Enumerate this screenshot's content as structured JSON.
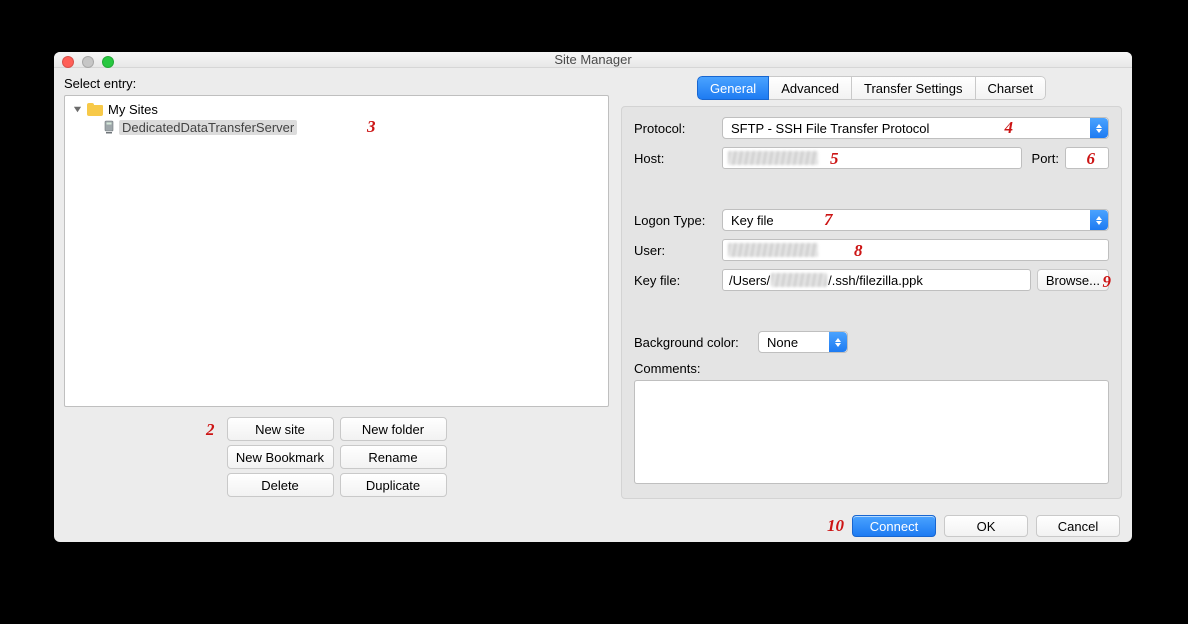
{
  "window": {
    "title": "Site Manager"
  },
  "left": {
    "select_label": "Select entry:",
    "root_label": "My Sites",
    "site_name": "DedicatedDataTransferServer",
    "buttons": {
      "new_site": "New site",
      "new_folder": "New folder",
      "new_bookmark": "New Bookmark",
      "rename": "Rename",
      "delete": "Delete",
      "duplicate": "Duplicate"
    }
  },
  "tabs": {
    "general": "General",
    "advanced": "Advanced",
    "transfer": "Transfer Settings",
    "charset": "Charset"
  },
  "form": {
    "protocol_label": "Protocol:",
    "protocol_value": "SFTP - SSH File Transfer Protocol",
    "host_label": "Host:",
    "host_value": "",
    "port_label": "Port:",
    "port_value": "",
    "logon_label": "Logon Type:",
    "logon_value": "Key file",
    "user_label": "User:",
    "user_value": "",
    "keyfile_label": "Key file:",
    "keyfile_prefix": "/Users/",
    "keyfile_suffix": "/.ssh/filezilla.ppk",
    "browse_label": "Browse...",
    "bg_label": "Background color:",
    "bg_value": "None",
    "comments_label": "Comments:"
  },
  "bottom": {
    "connect": "Connect",
    "ok": "OK",
    "cancel": "Cancel"
  },
  "annotations": {
    "a2": "2",
    "a3": "3",
    "a4": "4",
    "a5": "5",
    "a6": "6",
    "a7": "7",
    "a8": "8",
    "a9": "9",
    "a10": "10"
  }
}
